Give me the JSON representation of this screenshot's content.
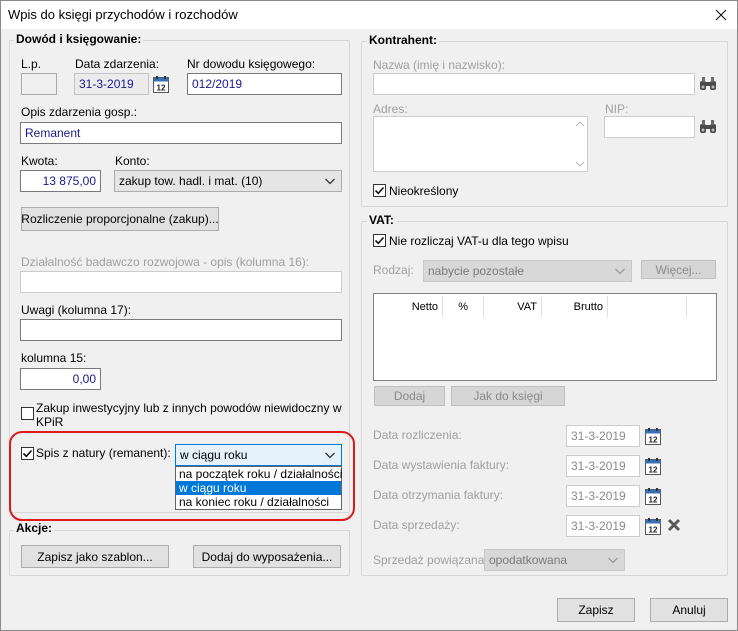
{
  "window": {
    "title": "Wpis do księgi przychodów i rozchodów"
  },
  "dowod": {
    "title": "Dowód i księgowanie:",
    "lp_label": "L.p.",
    "data_zdarzenia_label": "Data zdarzenia:",
    "data_zdarzenia_value": "31-3-2019",
    "nr_dowodu_label": "Nr dowodu księgowego:",
    "nr_dowodu_value": "012/2019",
    "opis_label": "Opis zdarzenia gosp.:",
    "opis_value": "Remanent",
    "kwota_label": "Kwota:",
    "kwota_value": "13 875,00",
    "konto_label": "Konto:",
    "konto_value": "zakup tow. hadl. i mat. (10)",
    "rozliczenie_button": "Rozliczenie proporcjonalne (zakup)...",
    "dzialalnosc_label": "Działalność badawczo rozwojowa - opis (kolumna 16):",
    "uwagi_label": "Uwagi (kolumna 17):",
    "kolumna15_label": "kolumna 15:",
    "kolumna15_value": "0,00",
    "zakup_inwest_label_1": "Zakup inwestycyjny lub z innych powodów niewidoczny w",
    "zakup_inwest_label_2": "KPiR",
    "spis_label": "Spis z natury (remanent):",
    "spis_value": "w ciągu roku",
    "spis_options": [
      "na początek roku / działalności",
      "w ciągu roku",
      "na koniec roku / działalności"
    ],
    "spis_selected_index": 1
  },
  "akcje": {
    "title": "Akcje:",
    "szablon_button": "Zapisz jako szablon...",
    "wyposazenie_button": "Dodaj do wyposażenia..."
  },
  "kontrahent": {
    "title": "Kontrahent:",
    "nazwa_label": "Nazwa (imię i nazwisko):",
    "adres_label": "Adres:",
    "nip_label": "NIP:",
    "nieokreslony_label": "Nieokreślony"
  },
  "vat": {
    "title": "VAT:",
    "nie_rozliczaj_label": "Nie rozliczaj VAT-u dla tego wpisu",
    "rodzaj_label": "Rodzaj:",
    "rodzaj_value": "nabycie pozostałe",
    "wiecej_button": "Więcej...",
    "columns": [
      "Netto",
      "%",
      "VAT",
      "Brutto"
    ],
    "dodaj_button": "Dodaj",
    "jak_do_ksiegi_button": "Jak do księgi",
    "data_rozliczenia_label": "Data rozliczenia:",
    "data_rozliczenia_value": "31-3-2019",
    "data_wystawienia_label": "Data wystawienia faktury:",
    "data_wystawienia_value": "31-3-2019",
    "data_otrzymania_label": "Data otrzymania faktury:",
    "data_otrzymania_value": "31-3-2019",
    "data_sprzedazy_label": "Data sprzedaży:",
    "data_sprzedazy_value": "31-3-2019",
    "sprzedaz_powiazana_label": "Sprzedaż powiązana:",
    "sprzedaz_powiazana_value": "opodatkowana"
  },
  "footer": {
    "zapisz_button": "Zapisz",
    "anuluj_button": "Anuluj"
  },
  "colors": {
    "highlight_ring": "#e0191d",
    "selection": "#0078d7",
    "input_text": "#1a1a8c"
  },
  "icons": {
    "calendar": "calendar-icon",
    "binoculars": "binoculars-icon",
    "close": "close-icon",
    "chevron": "chevron-down-icon",
    "check": "checkmark-icon"
  }
}
